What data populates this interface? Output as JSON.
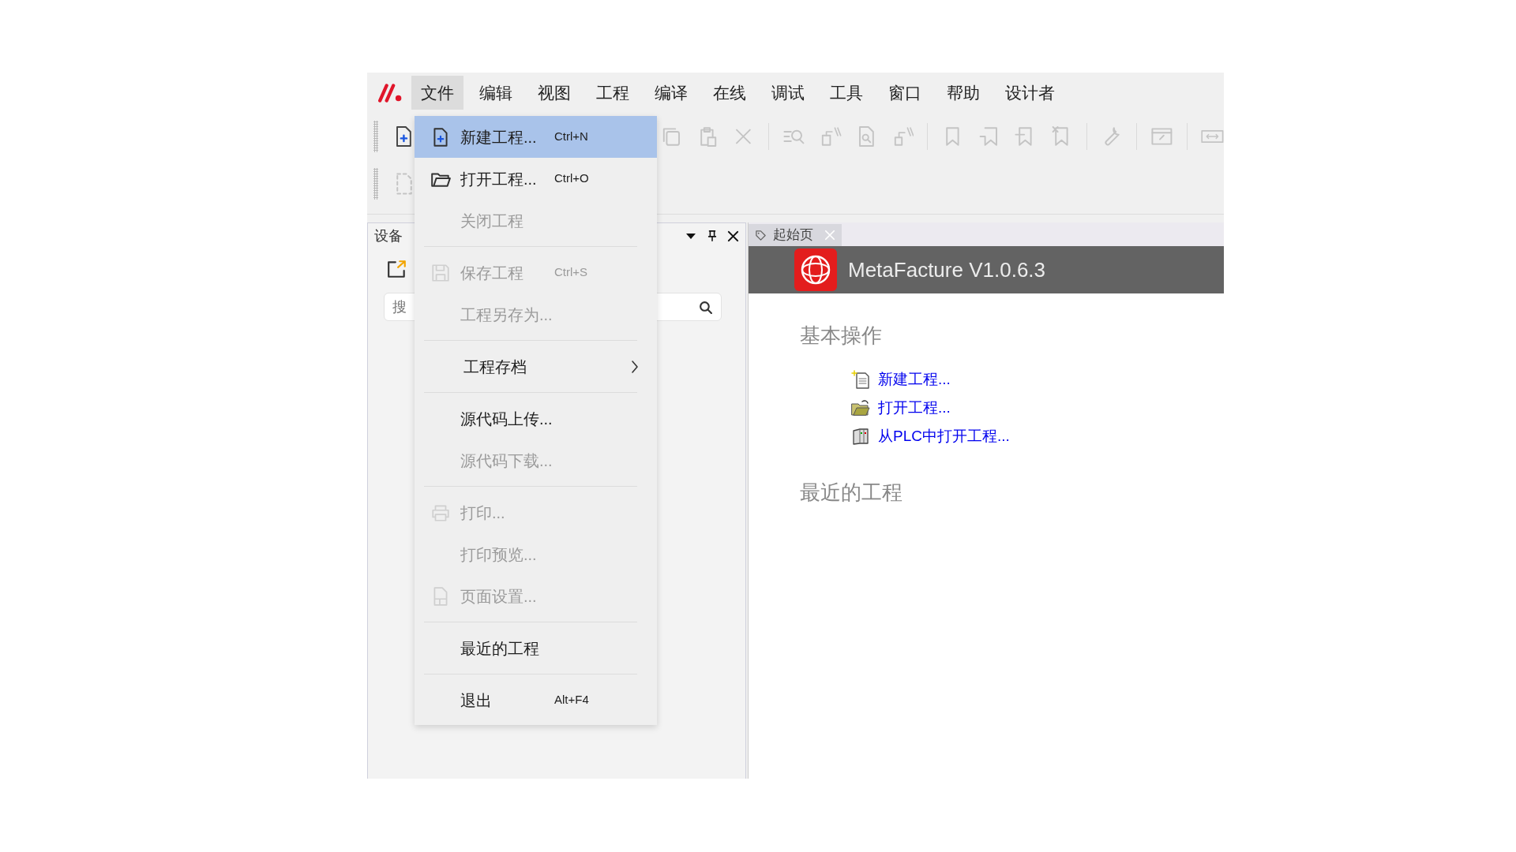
{
  "menu_bar": [
    {
      "label": "文件",
      "selected": true
    },
    {
      "label": "编辑",
      "selected": false
    },
    {
      "label": "视图",
      "selected": false
    },
    {
      "label": "工程",
      "selected": false
    },
    {
      "label": "编译",
      "selected": false
    },
    {
      "label": "在线",
      "selected": false
    },
    {
      "label": "调试",
      "selected": false
    },
    {
      "label": "工具",
      "selected": false
    },
    {
      "label": "窗口",
      "selected": false
    },
    {
      "label": "帮助",
      "selected": false
    },
    {
      "label": "设计者",
      "selected": false
    }
  ],
  "file_menu": {
    "items": [
      {
        "kind": "item",
        "label": "新建工程...",
        "shortcut": "Ctrl+N",
        "selected": true,
        "disabled": false
      },
      {
        "kind": "item",
        "label": "打开工程...",
        "shortcut": "Ctrl+O",
        "selected": false,
        "disabled": false
      },
      {
        "kind": "item",
        "label": "关闭工程",
        "selected": false,
        "disabled": true
      },
      {
        "kind": "separator"
      },
      {
        "kind": "item",
        "label": "保存工程",
        "shortcut": "Ctrl+S",
        "selected": false,
        "disabled": true
      },
      {
        "kind": "item",
        "label": "工程另存为...",
        "selected": false,
        "disabled": true
      },
      {
        "kind": "separator"
      },
      {
        "kind": "submenu",
        "label": "工程存档",
        "selected": false,
        "disabled": false
      },
      {
        "kind": "separator"
      },
      {
        "kind": "item",
        "label": "源代码上传...",
        "selected": false,
        "disabled": false
      },
      {
        "kind": "item",
        "label": "源代码下载...",
        "selected": false,
        "disabled": true
      },
      {
        "kind": "separator"
      },
      {
        "kind": "item",
        "label": "打印...",
        "selected": false,
        "disabled": true
      },
      {
        "kind": "item",
        "label": "打印预览...",
        "selected": false,
        "disabled": true
      },
      {
        "kind": "item",
        "label": "页面设置...",
        "selected": false,
        "disabled": true
      },
      {
        "kind": "separator"
      },
      {
        "kind": "item",
        "label": "最近的工程",
        "selected": false,
        "disabled": false
      },
      {
        "kind": "separator"
      },
      {
        "kind": "item",
        "label": "退出",
        "shortcut": "Alt+F4",
        "selected": false,
        "disabled": false
      }
    ]
  },
  "device_panel": {
    "title": "设备",
    "search": {
      "placeholder": "搜"
    }
  },
  "tabs": [
    {
      "label": "起始页",
      "selected": true
    }
  ],
  "start_page": {
    "title": "MetaFacture V1.0.6.3",
    "sections": [
      {
        "heading": "基本操作",
        "links": [
          {
            "label": "新建工程..."
          },
          {
            "label": "打开工程..."
          },
          {
            "label": "从PLC中打开工程..."
          }
        ]
      },
      {
        "heading": "最近的工程"
      }
    ]
  }
}
